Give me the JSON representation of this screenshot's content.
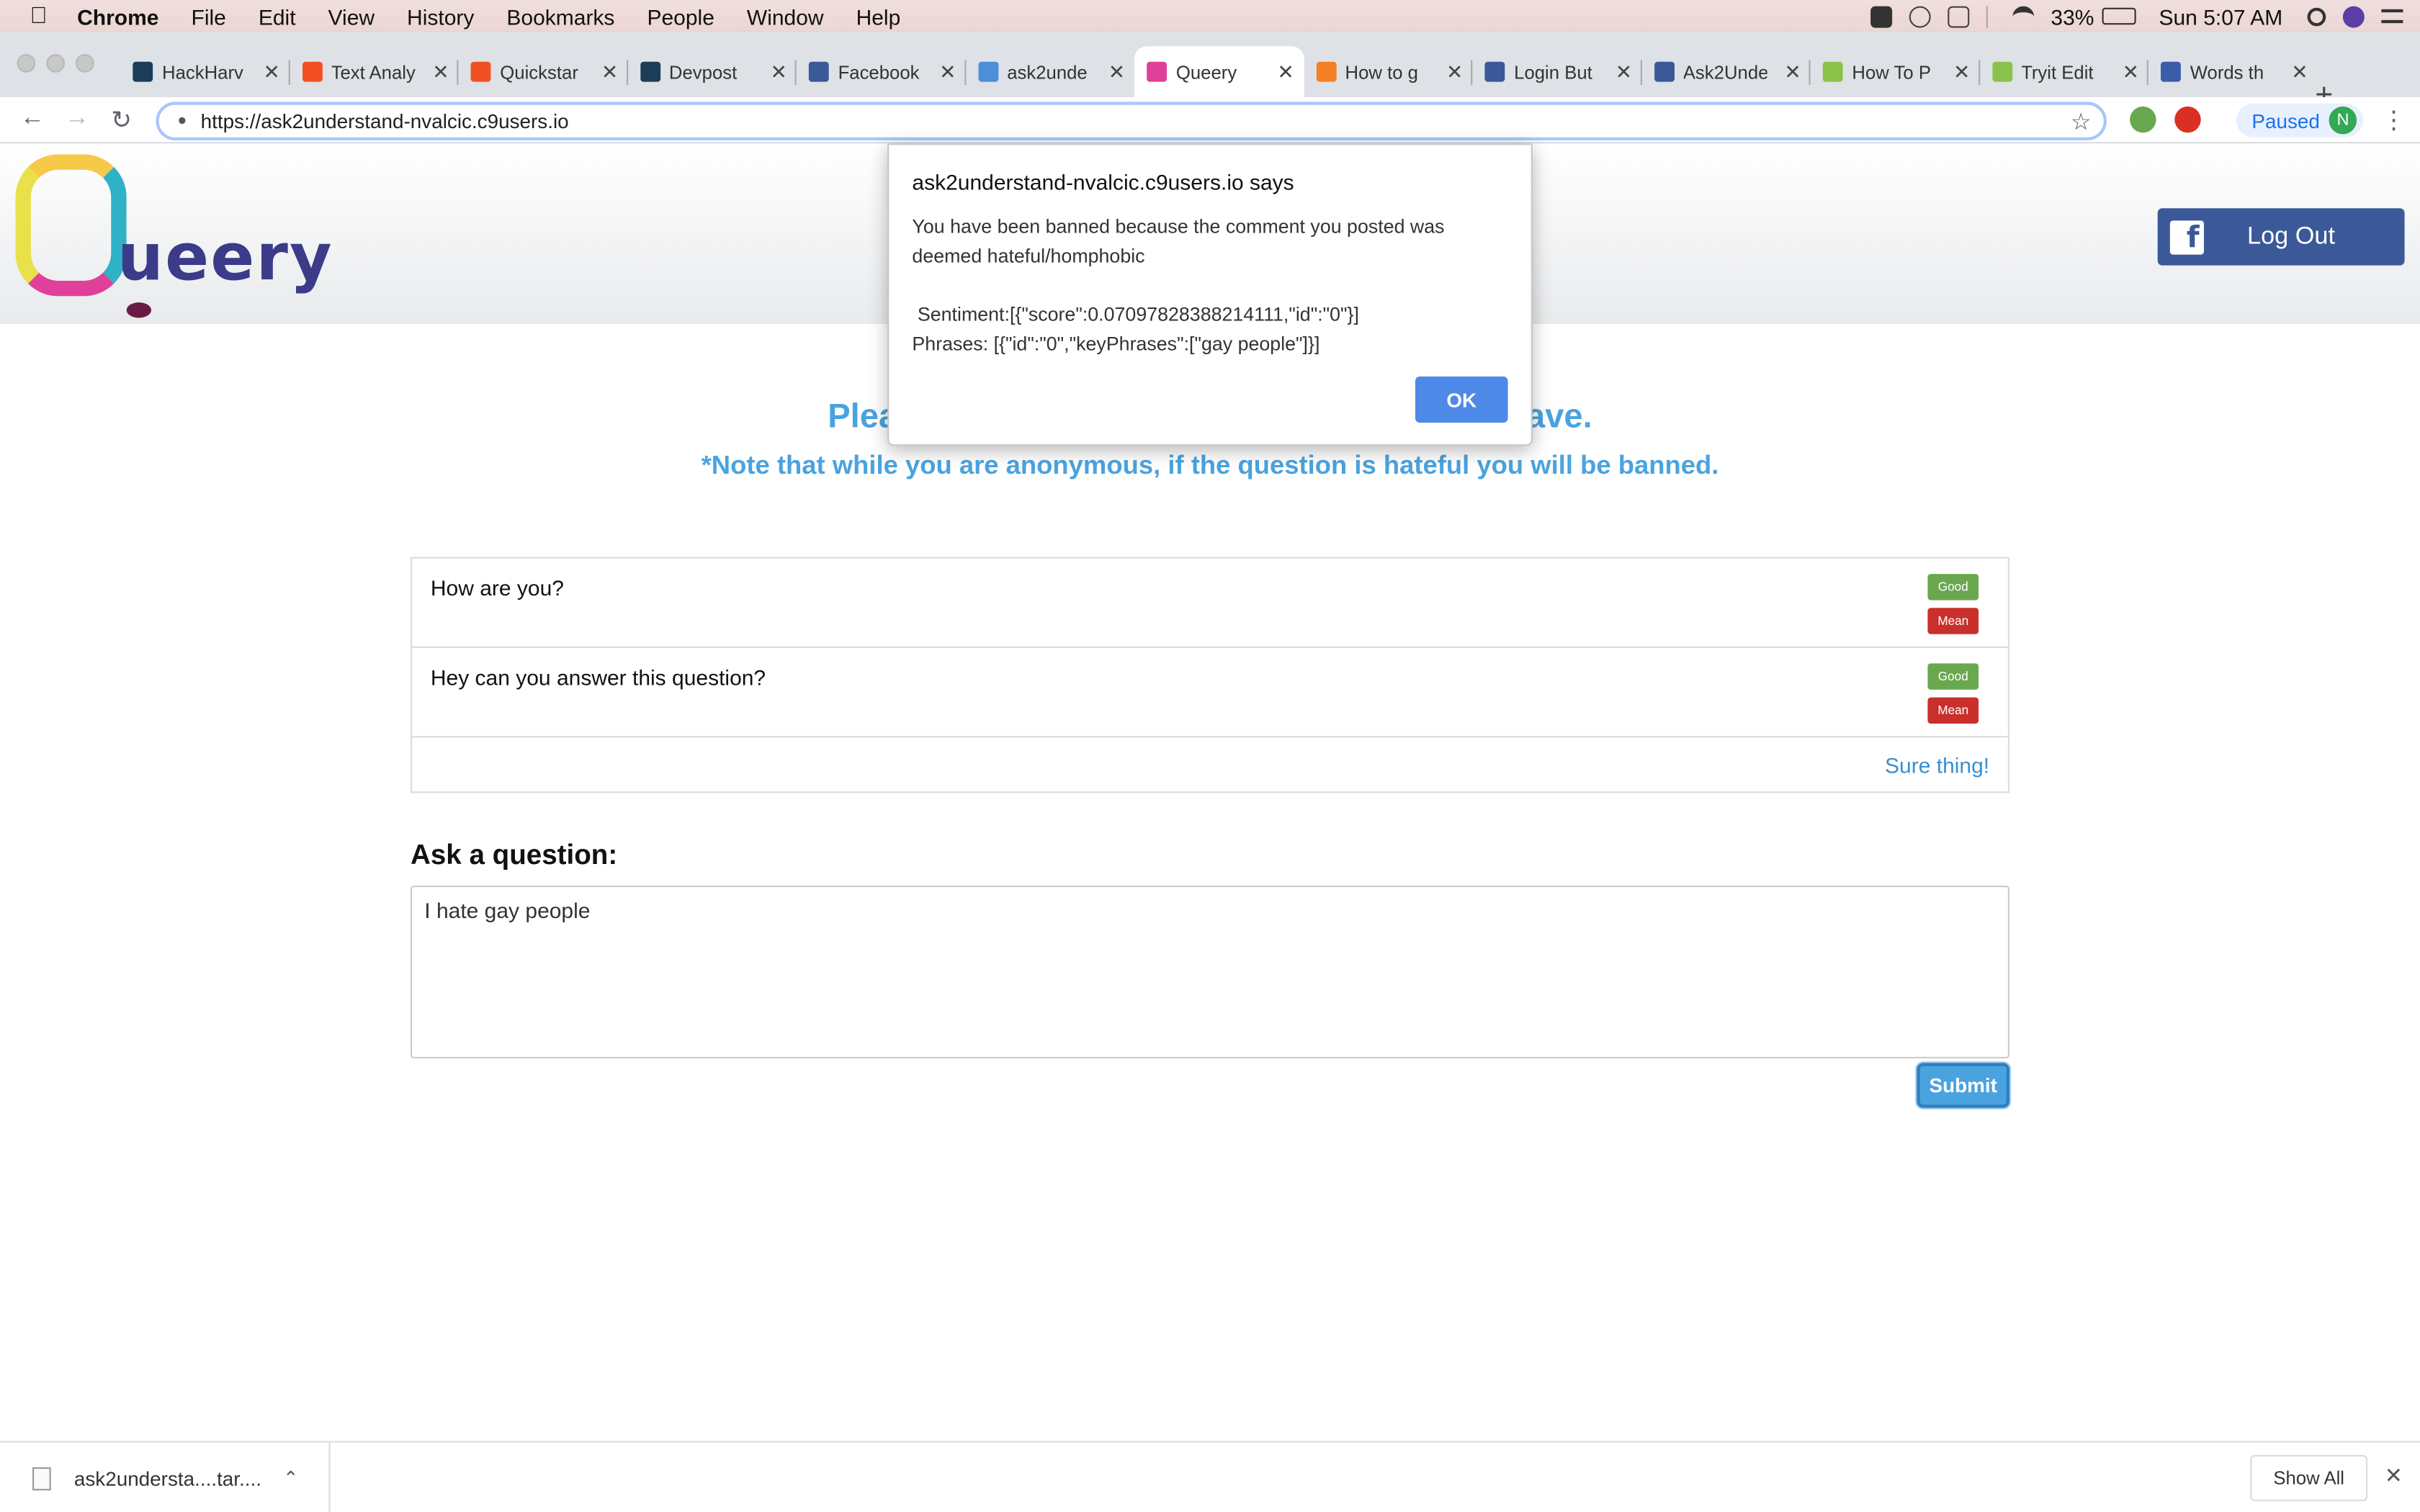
{
  "menubar": {
    "app": "Chrome",
    "items": [
      "File",
      "Edit",
      "View",
      "History",
      "Bookmarks",
      "People",
      "Window",
      "Help"
    ],
    "battery": "33%",
    "clock": "Sun 5:07 AM"
  },
  "tabs": [
    {
      "label": "HackHarv",
      "icon": "devpost-icon",
      "color": "#1c3d5a"
    },
    {
      "label": "Text Analy",
      "icon": "microsoft-icon",
      "color": "#f25022"
    },
    {
      "label": "Quickstar",
      "icon": "microsoft-icon",
      "color": "#f25022"
    },
    {
      "label": "Devpost",
      "icon": "devpost-icon",
      "color": "#1c3d5a"
    },
    {
      "label": "Facebook",
      "icon": "facebook-icon",
      "color": "#3b5998"
    },
    {
      "label": "ask2unde",
      "icon": "cloud9-icon",
      "color": "#4c8ed9"
    },
    {
      "label": "Queery",
      "icon": "queery-icon",
      "color": "#e0409a"
    },
    {
      "label": "How to g",
      "icon": "stackoverflow-icon",
      "color": "#f48024"
    },
    {
      "label": "Login But",
      "icon": "facebook-icon",
      "color": "#3b5998"
    },
    {
      "label": "Ask2Unde",
      "icon": "facebook-icon",
      "color": "#3b5998"
    },
    {
      "label": "How To P",
      "icon": "w3schools-icon",
      "color": "#8bc34a"
    },
    {
      "label": "Tryit Edit",
      "icon": "w3schools-icon",
      "color": "#8bc34a"
    },
    {
      "label": "Words th",
      "icon": "yahoo-icon",
      "color": "#3b5ca8"
    }
  ],
  "omnibox": {
    "url": "https://ask2understand-nvalcic.c9users.io"
  },
  "profile": {
    "status": "Paused",
    "initial": "N"
  },
  "site": {
    "logo_word": "ueery",
    "logout_label": "Log Out",
    "fb_glyph": "f",
    "headline_left": "Please r",
    "headline_right": "ay have.",
    "note": "*Note that while you are anonymous, if the question is hateful you will be banned."
  },
  "questions": [
    {
      "text": "How are you?",
      "good": "Good",
      "mean": "Mean"
    },
    {
      "text": "Hey can you answer this question?",
      "good": "Good",
      "mean": "Mean"
    }
  ],
  "answer": "Sure thing!",
  "ask": {
    "label": "Ask a question:",
    "value": "I hate gay people",
    "submit": "Submit"
  },
  "dialog": {
    "title": "ask2understand-nvalcic.c9users.io says",
    "message": "You have been banned because the comment you posted was deemed hateful/homphobic\n\n Sentiment:[{\"score\":0.07097828388214111,\"id\":\"0\"}]\nPhrases: [{\"id\":\"0\",\"keyPhrases\":[\"gay people\"]}]",
    "ok": "OK"
  },
  "downloads": {
    "file": "ask2understa....tar....",
    "show_all": "Show All"
  }
}
